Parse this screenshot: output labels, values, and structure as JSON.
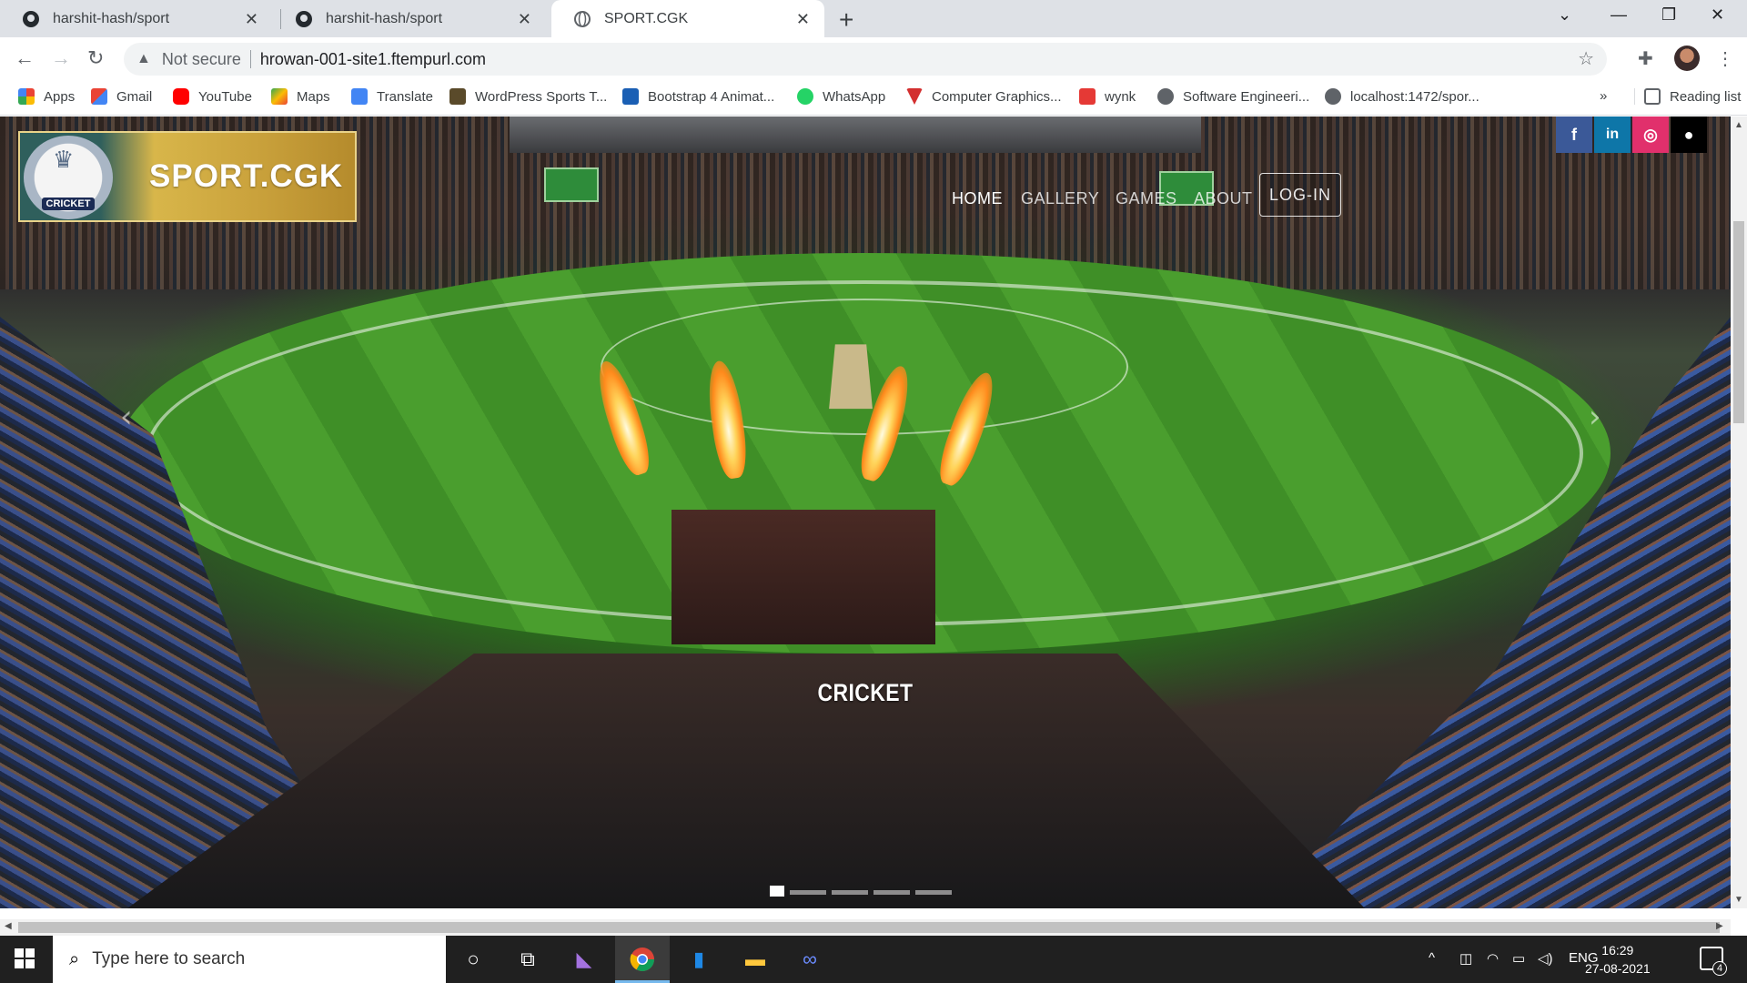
{
  "browser": {
    "tabs": [
      {
        "title": "harshit-hash/sport",
        "icon": "github-icon",
        "active": false
      },
      {
        "title": "harshit-hash/sport",
        "icon": "github-icon",
        "active": false
      },
      {
        "title": "SPORT.CGK",
        "icon": "globe-icon",
        "active": true
      }
    ],
    "omnibox": {
      "security_label": "Not secure",
      "url": "hrowan-001-site1.ftempurl.com"
    },
    "bookmarks": [
      {
        "label": "Apps",
        "icon": "apps-grid-icon"
      },
      {
        "label": "Gmail",
        "icon": "gmail-icon"
      },
      {
        "label": "YouTube",
        "icon": "youtube-icon"
      },
      {
        "label": "Maps",
        "icon": "maps-icon"
      },
      {
        "label": "Translate",
        "icon": "translate-icon"
      },
      {
        "label": "WordPress Sports T...",
        "icon": "wordpress-icon"
      },
      {
        "label": "Bootstrap 4 Animat...",
        "icon": "bootstrap-icon"
      },
      {
        "label": "WhatsApp",
        "icon": "whatsapp-icon"
      },
      {
        "label": "Computer Graphics...",
        "icon": "graphics-icon"
      },
      {
        "label": "wynk",
        "icon": "wynk-icon"
      },
      {
        "label": "Software Engineeri...",
        "icon": "globe-icon"
      },
      {
        "label": "localhost:1472/spor...",
        "icon": "globe-icon"
      }
    ],
    "overflow_label": "»",
    "reading_list": "Reading list"
  },
  "site": {
    "logo": {
      "title": "SPORT.CGK",
      "badge": "CRICKET"
    },
    "nav": {
      "home": "HOME",
      "gallery": "GALLERY",
      "games": "GAMES",
      "about": "ABOUT",
      "login": "LOG-IN"
    },
    "social": [
      {
        "name": "facebook",
        "glyph": "f",
        "color": "#3b5998"
      },
      {
        "name": "linkedin",
        "glyph": "in",
        "color": "#0e76a8"
      },
      {
        "name": "instagram",
        "glyph": "◎",
        "color": "#e1306c"
      },
      {
        "name": "github",
        "glyph": "●",
        "color": "#000000"
      }
    ],
    "carousel": {
      "caption": "CRICKET",
      "slide_count": 5,
      "active_index": 0
    }
  },
  "taskbar": {
    "search_placeholder": "Type here to search",
    "language": "ENG",
    "time": "16:29",
    "date": "27-08-2021",
    "notifications": "4"
  }
}
